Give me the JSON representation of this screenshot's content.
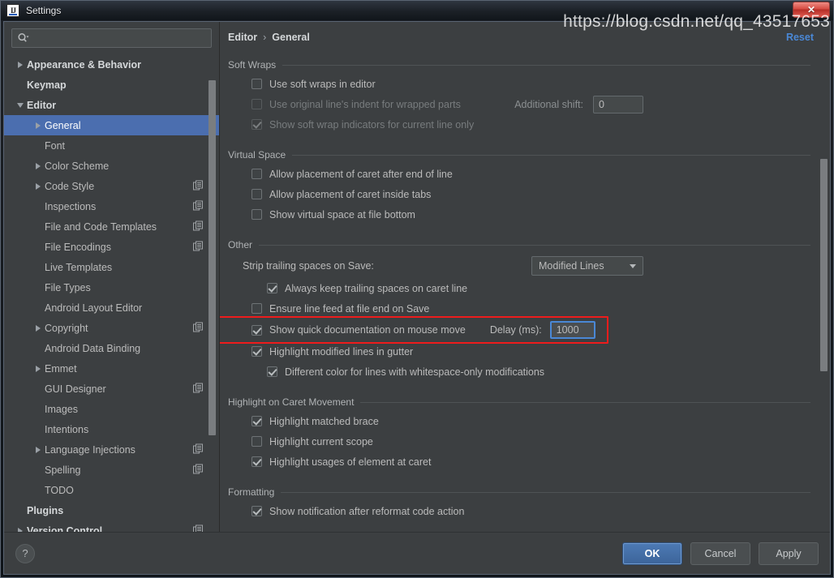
{
  "window": {
    "title": "Settings",
    "icon": "intellij-idea-icon",
    "close_label": "✕"
  },
  "sidebar": {
    "search": {
      "value": "",
      "placeholder": "",
      "icon": "search-icon"
    },
    "items": [
      {
        "label": "Appearance & Behavior",
        "indent": 0,
        "twisty": "right",
        "bold": true,
        "copy": false,
        "selected": false
      },
      {
        "label": "Keymap",
        "indent": 0,
        "twisty": "none",
        "bold": true,
        "copy": false,
        "selected": false
      },
      {
        "label": "Editor",
        "indent": 0,
        "twisty": "down",
        "bold": true,
        "copy": false,
        "selected": false
      },
      {
        "label": "General",
        "indent": 1,
        "twisty": "right",
        "bold": false,
        "copy": false,
        "selected": true
      },
      {
        "label": "Font",
        "indent": 1,
        "twisty": "none",
        "bold": false,
        "copy": false,
        "selected": false
      },
      {
        "label": "Color Scheme",
        "indent": 1,
        "twisty": "right",
        "bold": false,
        "copy": false,
        "selected": false
      },
      {
        "label": "Code Style",
        "indent": 1,
        "twisty": "right",
        "bold": false,
        "copy": true,
        "selected": false
      },
      {
        "label": "Inspections",
        "indent": 1,
        "twisty": "none",
        "bold": false,
        "copy": true,
        "selected": false
      },
      {
        "label": "File and Code Templates",
        "indent": 1,
        "twisty": "none",
        "bold": false,
        "copy": true,
        "selected": false
      },
      {
        "label": "File Encodings",
        "indent": 1,
        "twisty": "none",
        "bold": false,
        "copy": true,
        "selected": false
      },
      {
        "label": "Live Templates",
        "indent": 1,
        "twisty": "none",
        "bold": false,
        "copy": false,
        "selected": false
      },
      {
        "label": "File Types",
        "indent": 1,
        "twisty": "none",
        "bold": false,
        "copy": false,
        "selected": false
      },
      {
        "label": "Android Layout Editor",
        "indent": 1,
        "twisty": "none",
        "bold": false,
        "copy": false,
        "selected": false
      },
      {
        "label": "Copyright",
        "indent": 1,
        "twisty": "right",
        "bold": false,
        "copy": true,
        "selected": false
      },
      {
        "label": "Android Data Binding",
        "indent": 1,
        "twisty": "none",
        "bold": false,
        "copy": false,
        "selected": false
      },
      {
        "label": "Emmet",
        "indent": 1,
        "twisty": "right",
        "bold": false,
        "copy": false,
        "selected": false
      },
      {
        "label": "GUI Designer",
        "indent": 1,
        "twisty": "none",
        "bold": false,
        "copy": true,
        "selected": false
      },
      {
        "label": "Images",
        "indent": 1,
        "twisty": "none",
        "bold": false,
        "copy": false,
        "selected": false
      },
      {
        "label": "Intentions",
        "indent": 1,
        "twisty": "none",
        "bold": false,
        "copy": false,
        "selected": false
      },
      {
        "label": "Language Injections",
        "indent": 1,
        "twisty": "right",
        "bold": false,
        "copy": true,
        "selected": false
      },
      {
        "label": "Spelling",
        "indent": 1,
        "twisty": "none",
        "bold": false,
        "copy": true,
        "selected": false
      },
      {
        "label": "TODO",
        "indent": 1,
        "twisty": "none",
        "bold": false,
        "copy": false,
        "selected": false
      },
      {
        "label": "Plugins",
        "indent": 0,
        "twisty": "none",
        "bold": true,
        "copy": false,
        "selected": false
      },
      {
        "label": "Version Control",
        "indent": 0,
        "twisty": "right",
        "bold": true,
        "copy": true,
        "selected": false
      }
    ],
    "scrollbar": {
      "thumb_top_pct": 6,
      "thumb_height_pct": 74
    }
  },
  "main": {
    "breadcrumb": {
      "root": "Editor",
      "separator": "›",
      "leaf": "General"
    },
    "reset_label": "Reset",
    "groups": {
      "soft_wraps": {
        "title": "Soft Wraps",
        "options": [
          {
            "label": "Use soft wraps in editor",
            "checked": false,
            "disabled": false
          },
          {
            "label": "Use original line's indent for wrapped parts",
            "checked": false,
            "disabled": true
          },
          {
            "label": "Show soft wrap indicators for current line only",
            "checked": true,
            "disabled": true
          }
        ],
        "additional_shift": {
          "label": "Additional shift:",
          "value": "0"
        }
      },
      "virtual_space": {
        "title": "Virtual Space",
        "options": [
          {
            "label": "Allow placement of caret after end of line",
            "checked": false,
            "disabled": false
          },
          {
            "label": "Allow placement of caret inside tabs",
            "checked": false,
            "disabled": false
          },
          {
            "label": "Show virtual space at file bottom",
            "checked": false,
            "disabled": false
          }
        ]
      },
      "other": {
        "title": "Other",
        "strip_label": "Strip trailing spaces on Save:",
        "strip_value": "Modified Lines",
        "options": [
          {
            "label": "Always keep trailing spaces on caret line",
            "checked": true,
            "disabled": false
          },
          {
            "label": "Ensure line feed at file end on Save",
            "checked": false,
            "disabled": false
          }
        ],
        "quick_doc": {
          "label": "Show quick documentation on mouse move",
          "checked": true,
          "delay_label": "Delay (ms):",
          "delay_value": "1000",
          "highlighted": true,
          "highlight_color": "#ee1c1c"
        },
        "gutter": {
          "label": "Highlight modified lines in gutter",
          "checked": true
        },
        "gutter_sub": {
          "label": "Different color for lines with whitespace-only modifications",
          "checked": true
        }
      },
      "highlight_caret": {
        "title": "Highlight on Caret Movement",
        "options": [
          {
            "label": "Highlight matched brace",
            "checked": true,
            "disabled": false
          },
          {
            "label": "Highlight current scope",
            "checked": false,
            "disabled": false
          },
          {
            "label": "Highlight usages of element at caret",
            "checked": true,
            "disabled": false
          }
        ]
      },
      "formatting": {
        "title": "Formatting",
        "options": [
          {
            "label": "Show notification after reformat code action",
            "checked": true,
            "disabled": false
          }
        ]
      }
    },
    "scrollbar": {
      "thumb_top_pct": 23,
      "thumb_height_pct": 44
    }
  },
  "footer": {
    "help_label": "?",
    "ok_label": "OK",
    "cancel_label": "Cancel",
    "apply_label": "Apply"
  },
  "watermark": "https://blog.csdn.net/qq_43517653"
}
